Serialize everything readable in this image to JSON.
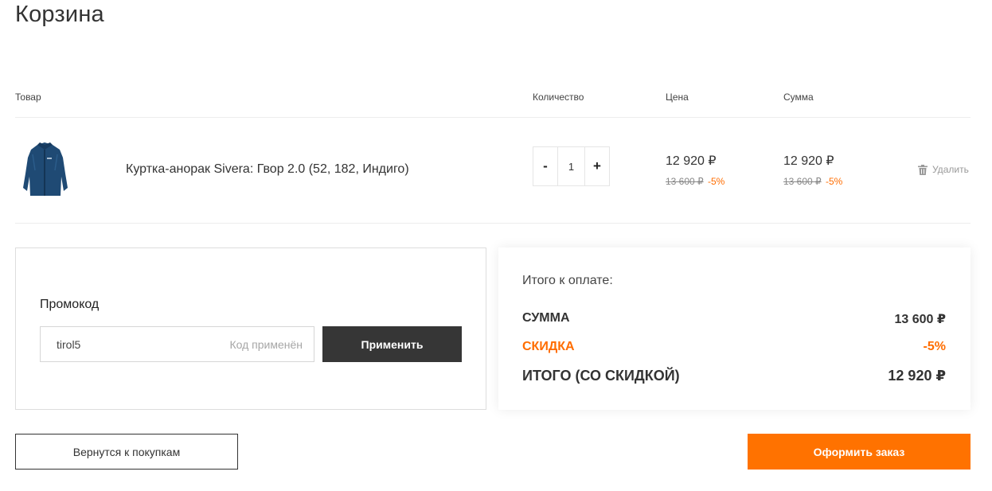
{
  "page": {
    "title": "Корзина"
  },
  "table_headers": {
    "product": "Товар",
    "quantity": "Количество",
    "price": "Цена",
    "sum": "Сумма"
  },
  "cart_items": [
    {
      "name": "Куртка-анорак Sivera: Гвор 2.0 (52, 182, Индиго)",
      "image_icon": "jacket-image",
      "quantity": "1",
      "decrement_label": "-",
      "increment_label": "+",
      "price": "12 920 ₽",
      "price_old": "13 600 ₽",
      "price_discount": "-5%",
      "sum": "12 920 ₽",
      "sum_old": "13 600 ₽",
      "sum_discount": "-5%",
      "delete_label": "Удалить"
    }
  ],
  "promo": {
    "label": "Промокод",
    "value": "tirol5",
    "status": "Код применён",
    "apply_label": "Применить"
  },
  "summary": {
    "title": "Итого к оплате:",
    "total_label": "СУММА",
    "total_value": "13 600 ₽",
    "discount_label": "СКИДКА",
    "discount_value": "-5%",
    "final_label": "ИТОГО (СО СКИДКОЙ)",
    "final_value": "12 920 ₽"
  },
  "actions": {
    "back_label": "Вернутся к покупкам",
    "checkout_label": "Оформить заказ"
  },
  "colors": {
    "accent": "#ff7200",
    "discount": "#ff6d00",
    "dark_button": "#363636",
    "jacket": "#1f4a74"
  }
}
